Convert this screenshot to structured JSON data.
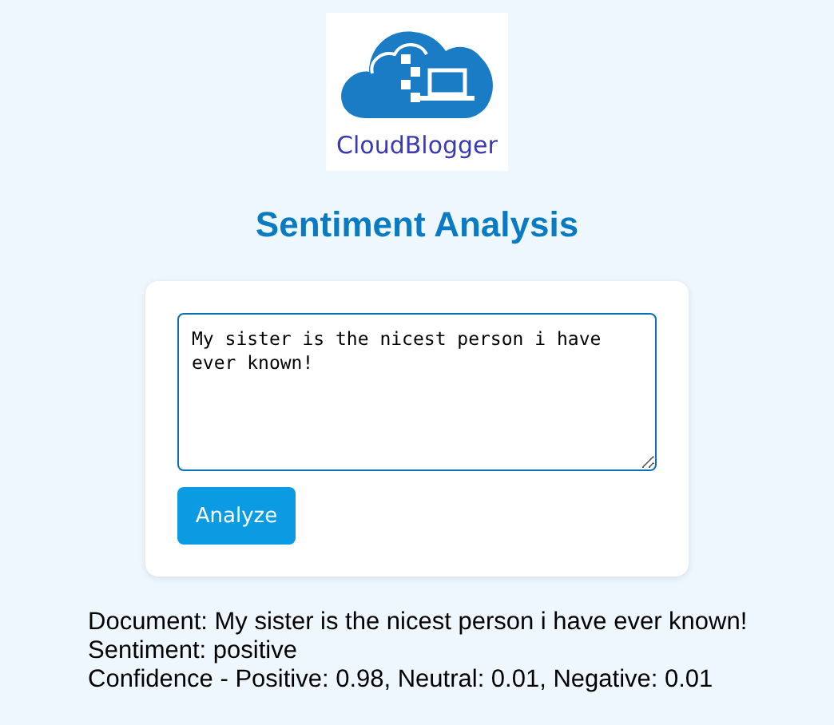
{
  "logo": {
    "name": "CloudBlogger"
  },
  "title": "Sentiment Analysis",
  "input": {
    "value": "My sister is the nicest person i have ever known!"
  },
  "button": {
    "label": "Analyze"
  },
  "results": [
    "Document: My sister is the nicest person i have ever known!",
    "Sentiment: positive",
    "Confidence - Positive: 0.98, Neutral: 0.01, Negative: 0.01"
  ]
}
